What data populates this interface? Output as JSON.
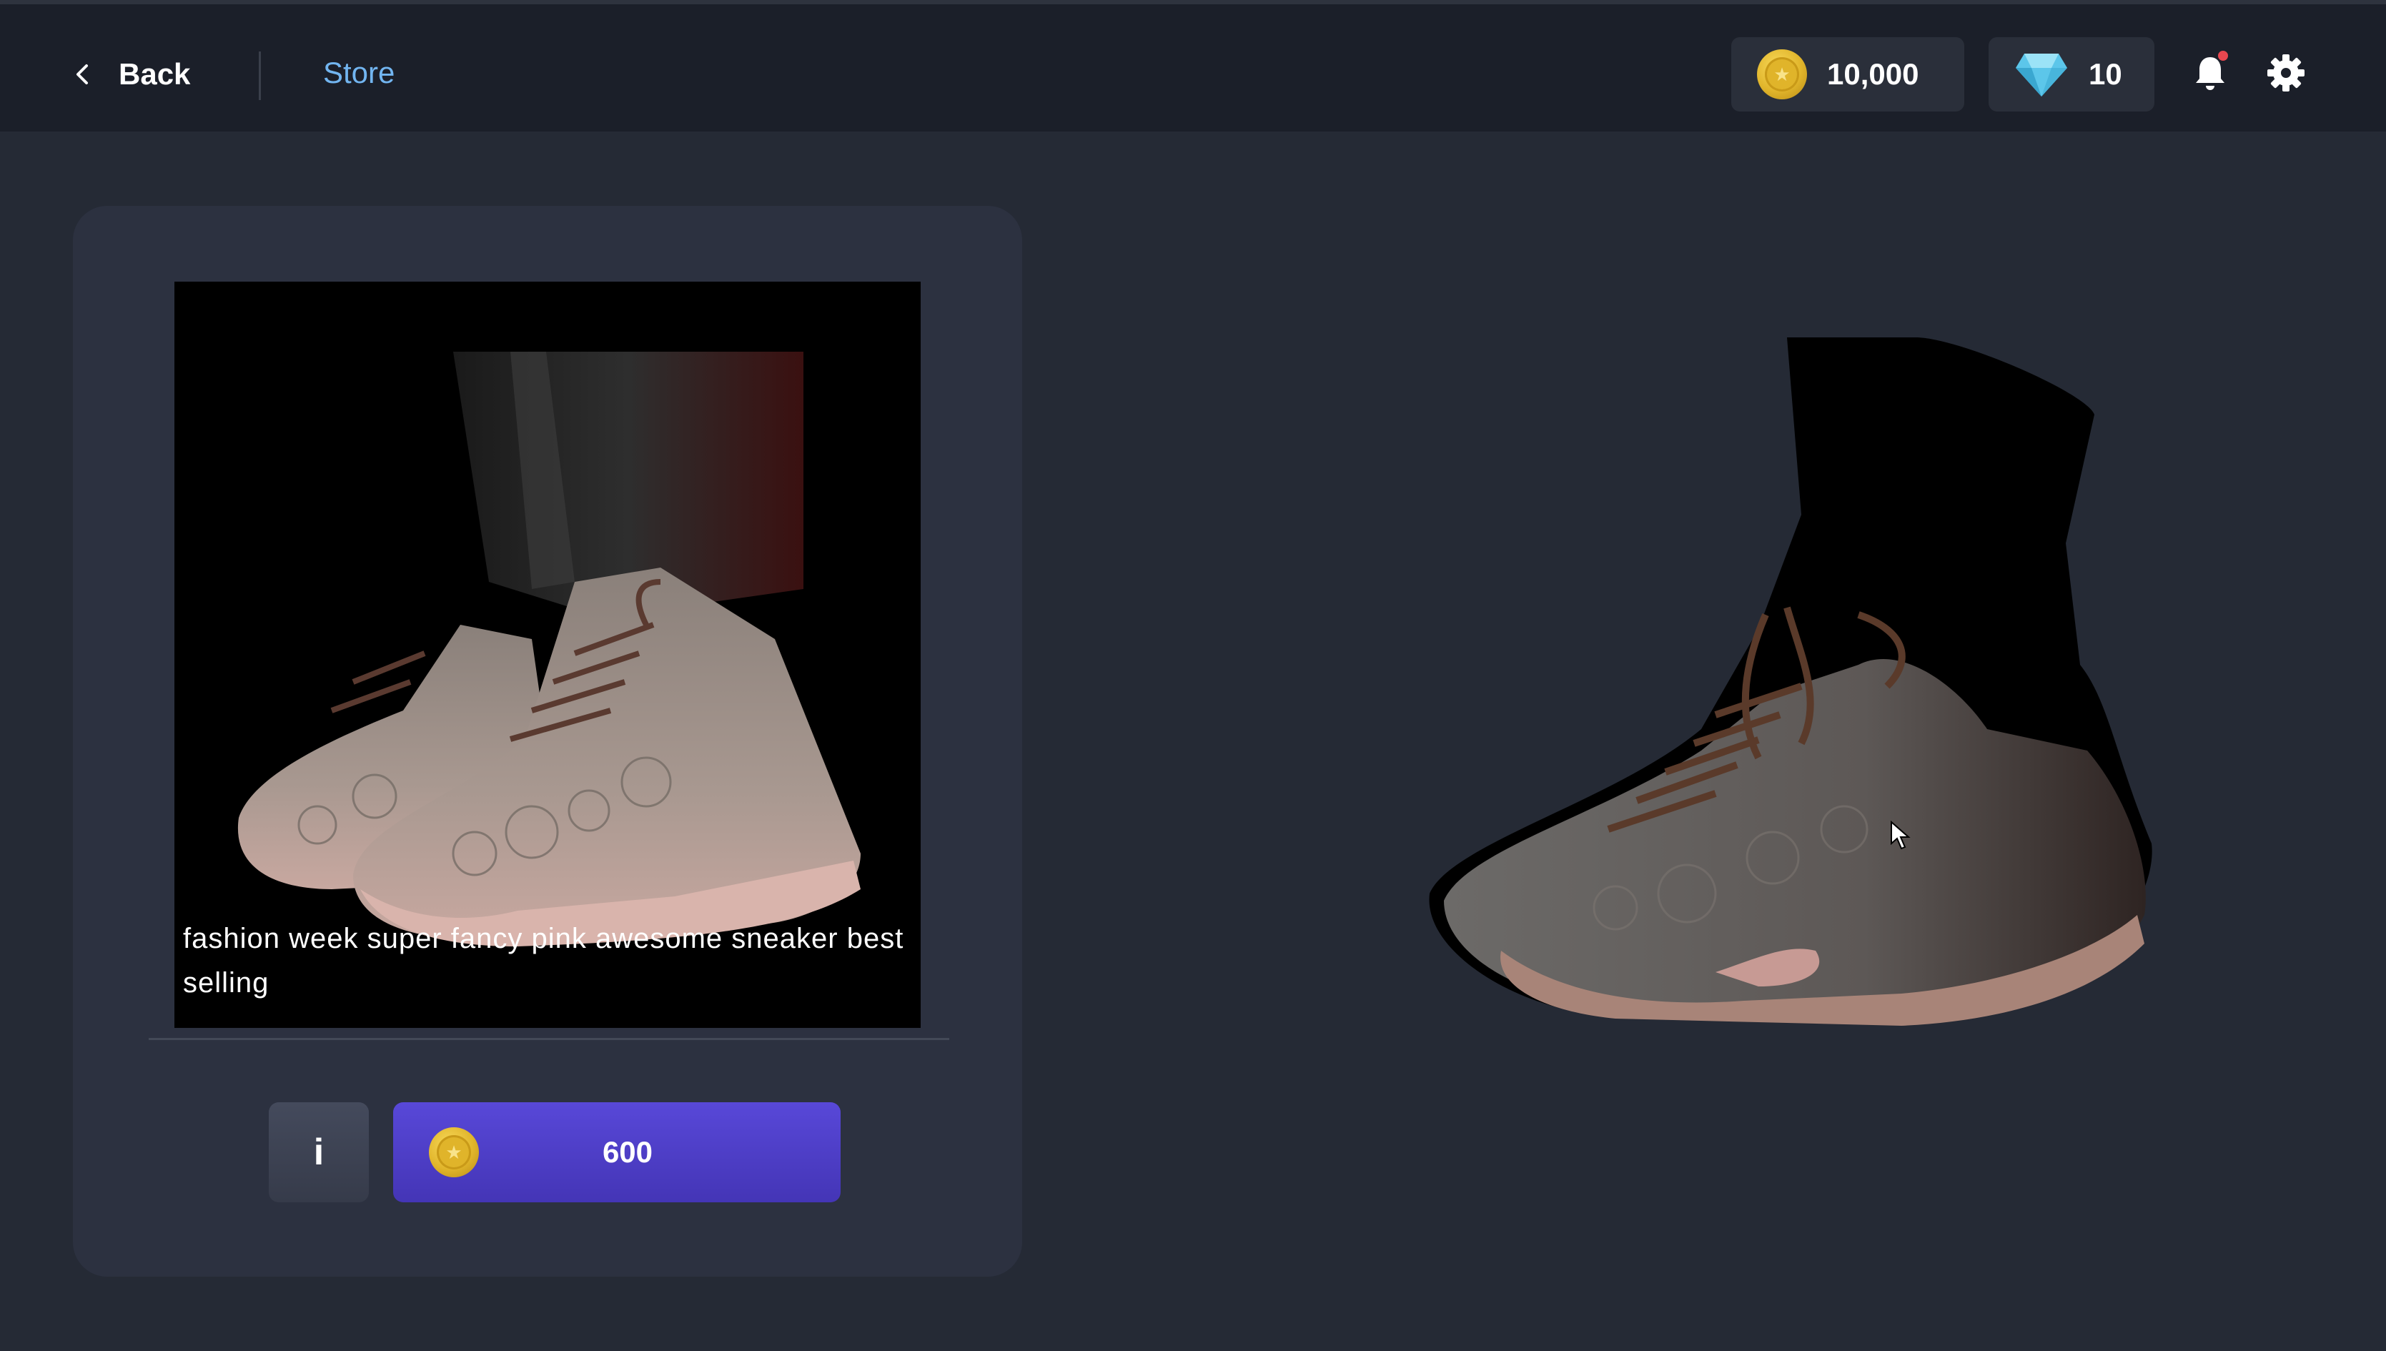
{
  "header": {
    "back_label": "Back",
    "store_label": "Store",
    "coins": "10,000",
    "gems": "10",
    "notification_dot_color": "#e8474f"
  },
  "item": {
    "description": "fashion week super fancy pink awesome sneaker best selling",
    "price": "600",
    "info_label": "i"
  },
  "colors": {
    "accent": "#4f40c8",
    "link": "#72b5f0",
    "coin": "#e1b52b",
    "gem": "#5cc6ea"
  }
}
